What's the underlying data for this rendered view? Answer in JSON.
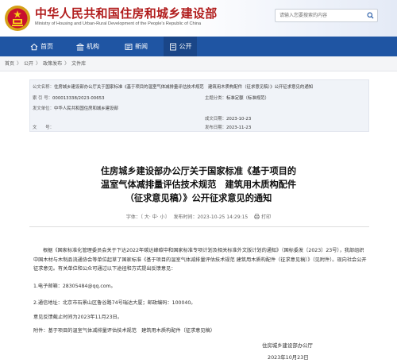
{
  "header": {
    "title": "中华人民共和国住房和城乡建设部",
    "subtitle": "Ministry of Housing and Urban-Rural Development of the People's Republic of China",
    "search_placeholder": "请输入您要搜索的内容"
  },
  "nav": {
    "items": [
      {
        "label": "首页",
        "icon": "home-icon"
      },
      {
        "label": "机构",
        "icon": "institution-icon"
      },
      {
        "label": "新闻",
        "icon": "news-icon"
      },
      {
        "label": "公开",
        "icon": "open-icon",
        "active": true
      }
    ]
  },
  "breadcrumb": {
    "items": [
      "首页",
      "公开",
      "政策发布",
      "文件库"
    ],
    "separator": "〉"
  },
  "info": {
    "title_label": "公文名称：",
    "title_value": "住房城乡建设部办公厅关于国家标准《基于项目的温室气体减排量评估技术规范　建筑用木质构配件（征求意见稿）》公开征求意见的通知",
    "index_label": "索 引 号：",
    "index_value": "000013338/2023-00653",
    "category_label": "主题分类：",
    "category_value": "标准定额（标准规范）",
    "issuer_label": "发文单位：",
    "issuer_value": "中华人民共和国住房和城乡建设部",
    "date_label": "成文日期：",
    "date_value": "2023-10-23",
    "docno_label": "文　　号：",
    "docno_value": "",
    "pubdate_label": "发布日期：",
    "pubdate_value": "2023-11-23"
  },
  "document": {
    "title_lines": [
      "住房城乡建设部办公厅关于国家标准《基于项目的",
      "温室气体减排量评估技术规范　建筑用木质构配件",
      "（征求意见稿）》公开征求意见的通知"
    ],
    "font_label": "字体：",
    "font_sizes": [
      "大",
      "中",
      "小"
    ],
    "publish_time": "发布时间：2023-10-25 14:29:15",
    "print_label": "打印",
    "paragraph": "根据《国家标准化管理委员会关于下达2022年碳达峰碳中和国家标准专项计划及相关标准外文版计划的通知》（国标委发〔2023〕23号），我部组织中国木材与木制品流通协会等单位起草了国家标准《基于项目的温室气体减排量评估技术规范 建筑用木质构配件（征求意见稿）》（见附件）。现向社会公开征求意见。有关单位和公众可通过以下途径和方式提出反馈意见：",
    "item1": "1.电子邮箱：28305484@qq.com。",
    "item2": "2.通信地址：北京市石景山区鲁谷路74号瑞达大厦；邮政编码：100040。",
    "deadline": "意见反馈截止时间为2023年11月23日。",
    "attachment": "附件：基于项目的温室气体减排量评估技术规范　建筑用木质构配件（征求意见稿）",
    "signature": "住房城乡建设部办公厅",
    "sign_date": "2023年10月23日"
  },
  "colors": {
    "nav_bg": "#1f55a3",
    "title_red": "#b11d1d",
    "panel_bg": "#f0f3f8"
  }
}
